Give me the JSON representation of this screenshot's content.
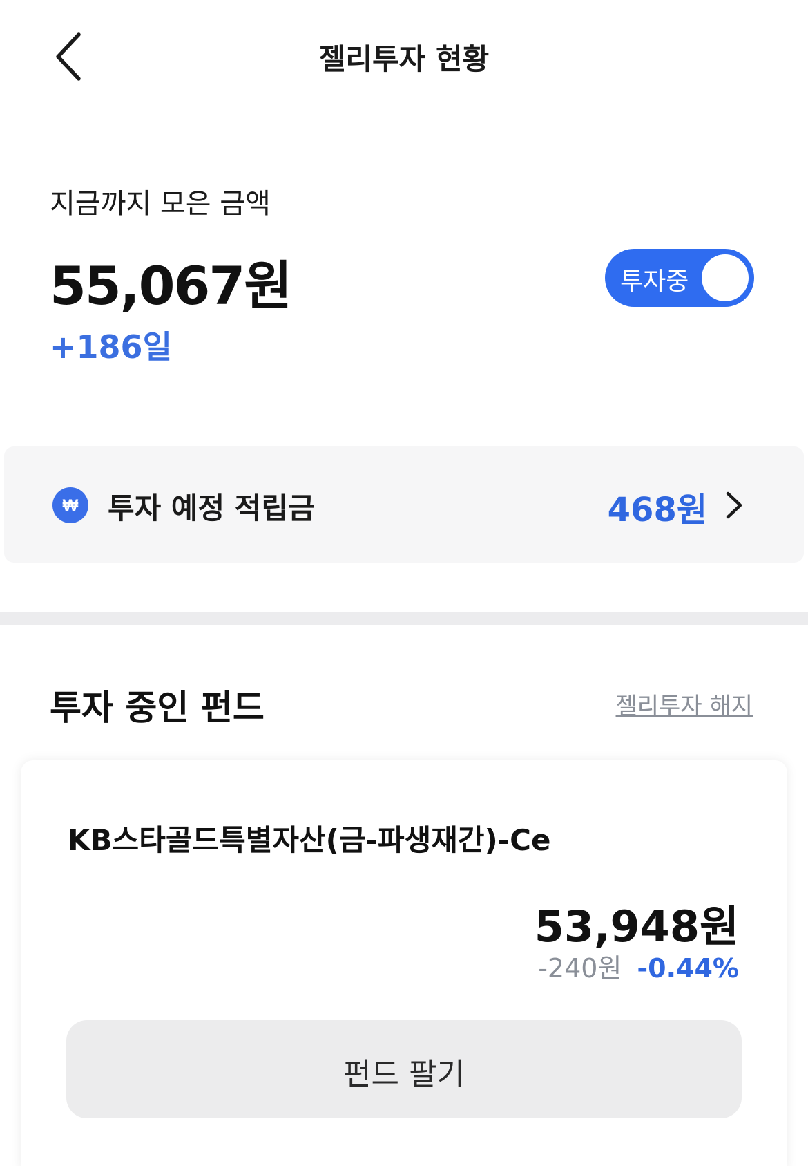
{
  "header": {
    "title": "젤리투자 현황",
    "back_icon": "chevron-left-icon"
  },
  "summary": {
    "label": "지금까지 모은 금액",
    "amount": "55,067원",
    "days": "+186일",
    "toggle": {
      "label": "투자중",
      "on": true,
      "color": "#2f6cf0"
    }
  },
  "pending": {
    "icon": "won-icon",
    "label": "투자 예정 적립금",
    "amount": "468원",
    "chevron": "chevron-right-icon"
  },
  "funds": {
    "title": "투자 중인 펀드",
    "cancel_label": "젤리투자 해지",
    "items": [
      {
        "name": "KB스타골드특별자산(금-파생재간)-Ce",
        "value": "53,948원",
        "change_amount": "-240원",
        "change_rate": "-0.44%",
        "sell_label": "펀드 팔기"
      }
    ]
  },
  "colors": {
    "accent": "#2f6cf0",
    "positive_blue": "#3067e0",
    "muted_text": "#8a8f98"
  }
}
